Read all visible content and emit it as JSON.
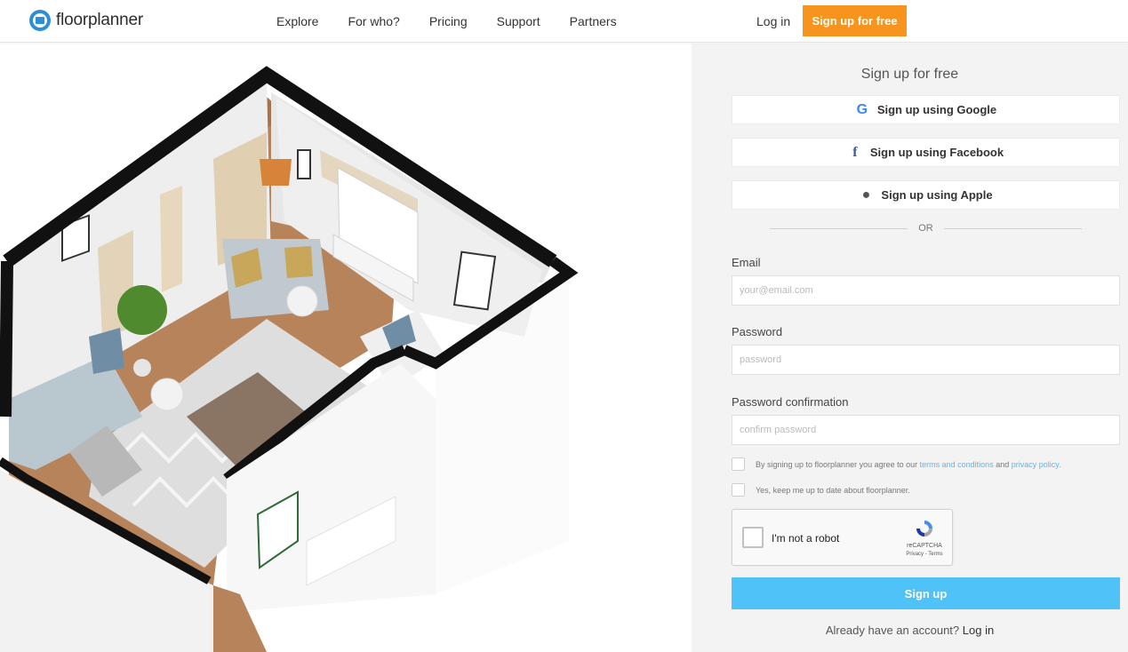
{
  "brand": {
    "name": "floorplanner",
    "color": "#2a8fd6"
  },
  "nav": {
    "items": [
      {
        "label": "Explore"
      },
      {
        "label": "For who?"
      },
      {
        "label": "Pricing"
      },
      {
        "label": "Support"
      },
      {
        "label": "Partners"
      }
    ],
    "login_label": "Log in",
    "signup_label": "Sign up for free",
    "signup_color": "#f7941d"
  },
  "form": {
    "title": "Sign up for free",
    "google_label": "Sign up using Google",
    "facebook_label": "Sign up using Facebook",
    "apple_label": "Sign up using Apple",
    "or_label": "OR",
    "email_label": "Email",
    "email_placeholder": "your@email.com",
    "password_label": "Password",
    "password_placeholder": "password",
    "confirm_label": "Password confirmation",
    "confirm_placeholder": "confirm password",
    "terms_prefix": "By signing up to floorplanner you agree to our",
    "terms_link": "terms and conditions",
    "terms_and": "and",
    "privacy_link": "privacy policy.",
    "newsletter_label": "Yes, keep me up to date about floorplanner.",
    "recaptcha_label": "I'm not a robot",
    "recaptcha_brand": "reCAPTCHA",
    "recaptcha_links": "Privacy - Terms",
    "submit_label": "Sign up",
    "submit_color": "#4fc2f7",
    "already_text": "Already have an account?",
    "already_link": "Log in"
  }
}
